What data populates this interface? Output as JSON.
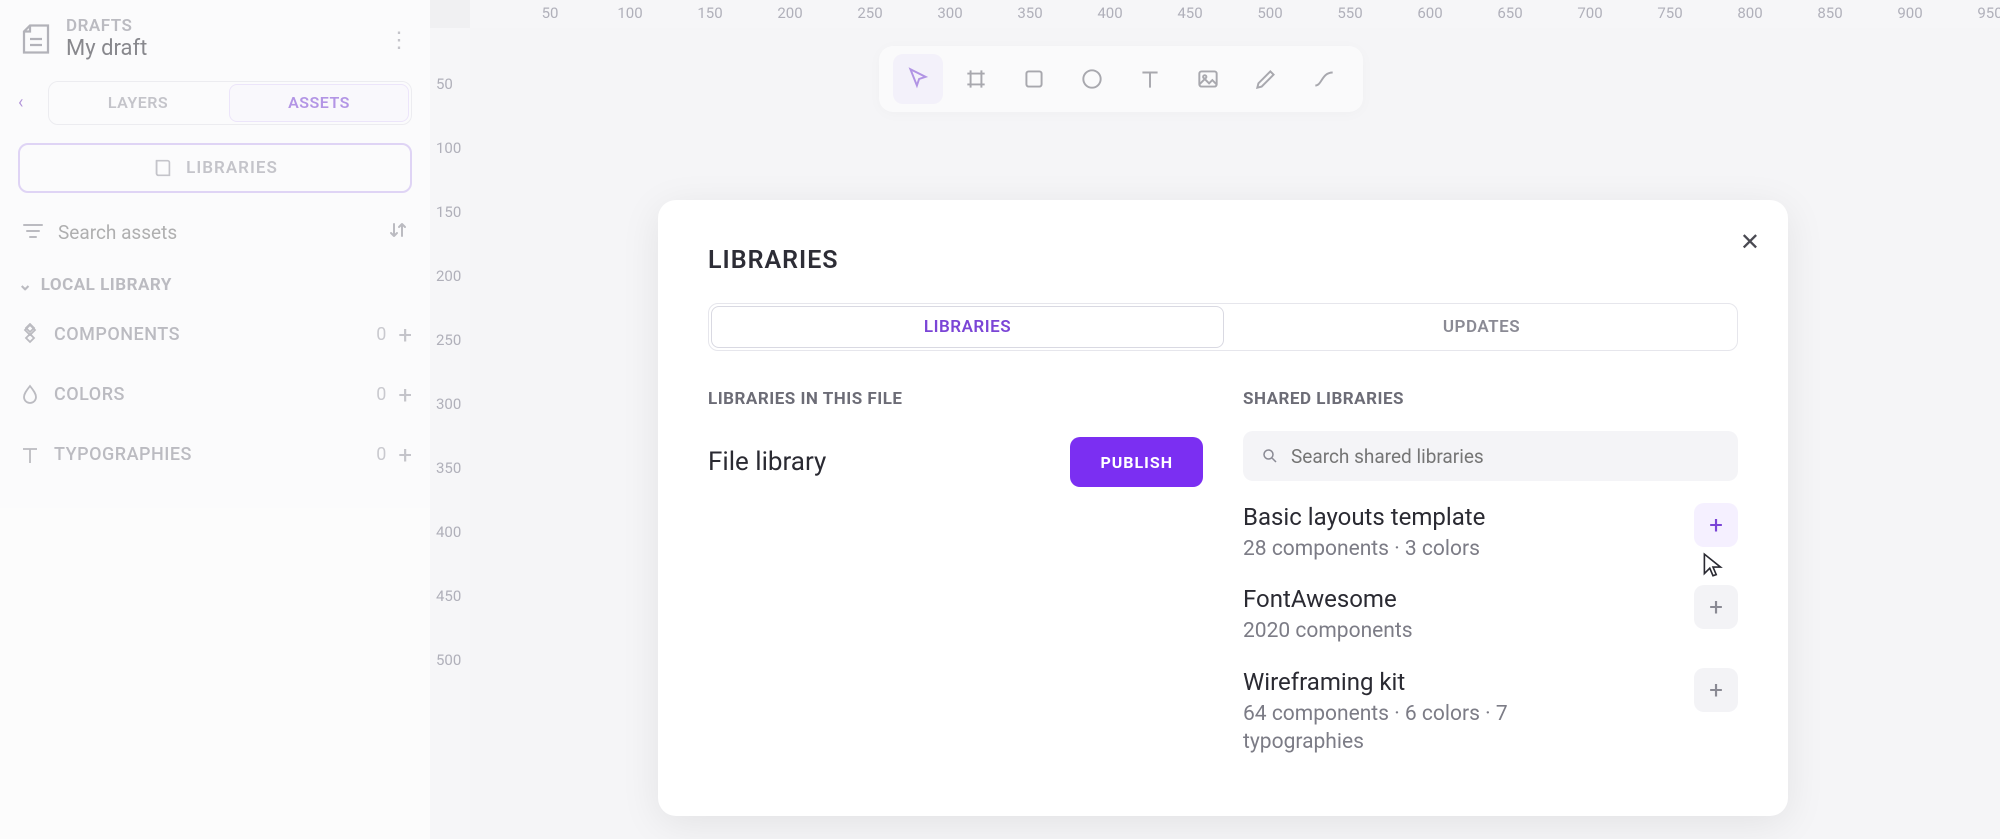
{
  "sidebar": {
    "drafts_label": "DRAFTS",
    "draft_name": "My draft",
    "tabs": {
      "layers": "LAYERS",
      "assets": "ASSETS"
    },
    "libraries_button": "LIBRARIES",
    "search_placeholder": "Search assets",
    "local_library_label": "LOCAL LIBRARY",
    "categories": [
      {
        "label": "COMPONENTS",
        "count": "0"
      },
      {
        "label": "COLORS",
        "count": "0"
      },
      {
        "label": "TYPOGRAPHIES",
        "count": "0"
      }
    ]
  },
  "ruler": {
    "h": [
      "50",
      "100",
      "150",
      "200",
      "250",
      "300",
      "350",
      "400",
      "450",
      "500",
      "550",
      "600",
      "650",
      "700",
      "750",
      "800",
      "850",
      "900",
      "950"
    ],
    "v": [
      "50",
      "100",
      "150",
      "200",
      "250",
      "300",
      "350",
      "400",
      "450",
      "500"
    ]
  },
  "modal": {
    "title": "LIBRARIES",
    "tabs": {
      "libraries": "LIBRARIES",
      "updates": "UPDATES"
    },
    "in_file_heading": "LIBRARIES IN THIS FILE",
    "file_library_name": "File library",
    "publish_label": "PUBLISH",
    "shared_heading": "SHARED LIBRARIES",
    "shared_search_placeholder": "Search shared libraries",
    "shared": [
      {
        "name": "Basic layouts template",
        "meta": "28 components · 3 colors"
      },
      {
        "name": "FontAwesome",
        "meta": "2020 components"
      },
      {
        "name": "Wireframing kit",
        "meta": "64 components · 6 colors · 7 typographies"
      }
    ]
  },
  "colors": {
    "accent": "#7b2ff2"
  }
}
